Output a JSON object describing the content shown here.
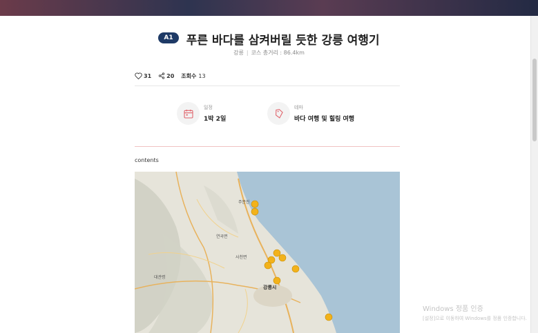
{
  "header": {
    "badge": "A1",
    "title": "푸른 바다를 삼켜버릴 듯한 강릉 여행기",
    "region": "강릉",
    "distance": "코스 총거리 : 86.4km"
  },
  "stats": {
    "likes": "31",
    "shares": "20",
    "views_label": "조회수",
    "views": "13"
  },
  "info": {
    "schedule_label": "일정",
    "schedule_value": "1박 2일",
    "theme_label": "테마",
    "theme_value": "바다 여행 및 힐링 여행"
  },
  "contents_label": "contents",
  "map": {
    "city_label": "강릉시",
    "place_labels": [
      "주문진",
      "사천면",
      "연곡면",
      "대관령"
    ],
    "marker_color": "#f2b21b",
    "sea_color": "#a9c4d6"
  },
  "watermark": {
    "line1": "Windows 정품 인증",
    "line2": "[설정]으로 이동하여 Windows를 정품 인증합니다."
  }
}
